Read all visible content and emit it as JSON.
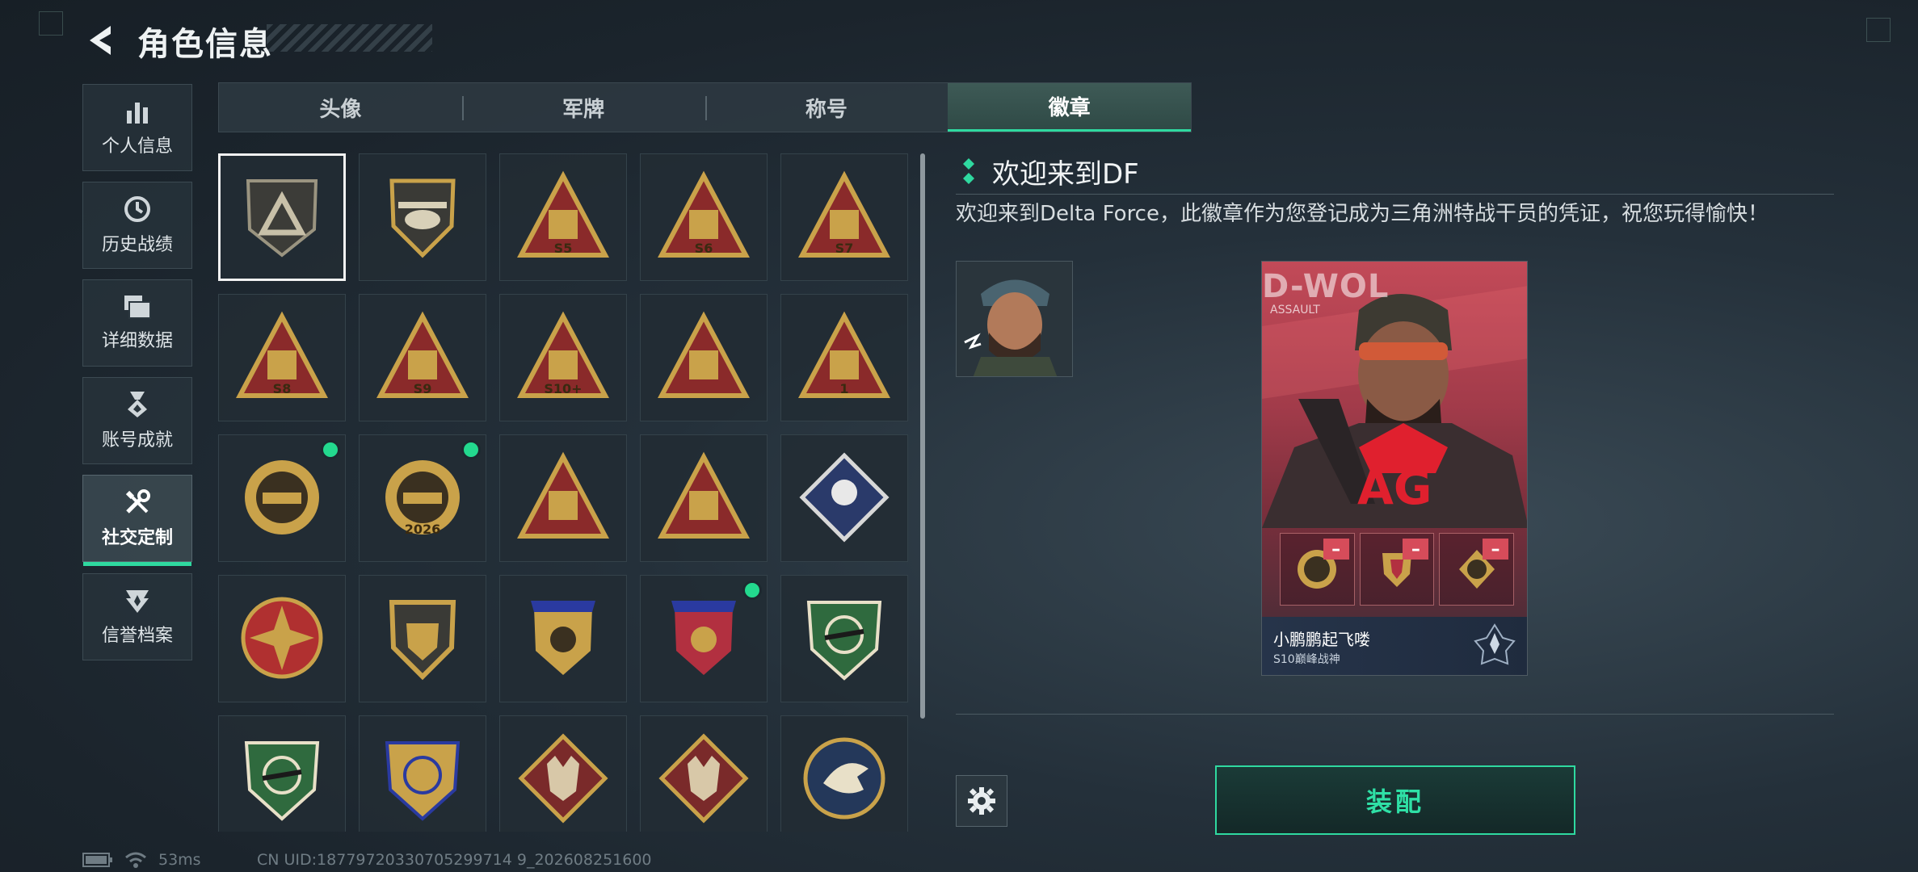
{
  "header": {
    "title": "角色信息"
  },
  "sidebar": {
    "items": [
      {
        "label": "个人信息",
        "icon": "bar-chart-icon"
      },
      {
        "label": "历史战绩",
        "icon": "history-icon"
      },
      {
        "label": "详细数据",
        "icon": "folder-icon"
      },
      {
        "label": "账号成就",
        "icon": "medal-icon"
      },
      {
        "label": "社交定制",
        "icon": "tools-icon",
        "active": true
      },
      {
        "label": "信誉档案",
        "icon": "shield-emblem-icon"
      }
    ]
  },
  "tabs": [
    {
      "label": "头像"
    },
    {
      "label": "军牌"
    },
    {
      "label": "称号"
    },
    {
      "label": "徽章",
      "active": true
    }
  ],
  "badges": [
    {
      "icon": "delta-triangle-badge",
      "selected": true
    },
    {
      "icon": "helicopter-badge"
    },
    {
      "icon": "s5-badge",
      "text": "S5"
    },
    {
      "icon": "s6-badge",
      "text": "S6"
    },
    {
      "icon": "s7-badge",
      "text": "S7"
    },
    {
      "icon": "s8-badge",
      "text": "S8"
    },
    {
      "icon": "s9-badge",
      "text": "S9"
    },
    {
      "icon": "s10-badge",
      "text": "S10+"
    },
    {
      "icon": "bowl-badge"
    },
    {
      "icon": "number-one-badge",
      "text": "1"
    },
    {
      "icon": "delta-force-2026-tank-badge",
      "new": true
    },
    {
      "icon": "delta-force-2026-globe-badge",
      "new": true,
      "text": "2026"
    },
    {
      "icon": "soldiers-badge"
    },
    {
      "icon": "rocket-badge"
    },
    {
      "icon": "rose-badge"
    },
    {
      "icon": "star-compass-badge"
    },
    {
      "icon": "shield-chevron-badge"
    },
    {
      "icon": "laurel-shield-badge"
    },
    {
      "icon": "laurel-shield-red-badge",
      "new": true
    },
    {
      "icon": "green-rifle-badge"
    },
    {
      "icon": "green-rifle-shield-badge"
    },
    {
      "icon": "gold-sniper-badge"
    },
    {
      "icon": "wolf-red-badge"
    },
    {
      "icon": "wolf-red-2-badge"
    },
    {
      "icon": "eagle-badge"
    }
  ],
  "detail": {
    "title": "欢迎来到DF",
    "description": "欢迎来到Delta Force，此徽章作为您登记成为三角洲特战干员的凭证，祝您玩得愉快！"
  },
  "card": {
    "operator_name": "D-WOL",
    "operator_role": "ASSAULT",
    "player_name": "小鹏鹏起飞喽",
    "rank": "S10巅峰战神",
    "slots": [
      {
        "icon": "delta-force-2026-tank-badge"
      },
      {
        "icon": "laurel-shield-badge"
      },
      {
        "icon": "delta-force-2026-globe-badge"
      }
    ]
  },
  "actions": {
    "equip_label": "装配",
    "settings_icon": "gear-icon"
  },
  "status_bar": {
    "ping": "53ms",
    "uid": "CN UID:18779720330705299714 9_202608251600"
  },
  "colors": {
    "accent": "#2fd9a0",
    "new_dot": "#23d98e",
    "card_red": "#c24a58",
    "badge_gold": "#c9a24a"
  }
}
